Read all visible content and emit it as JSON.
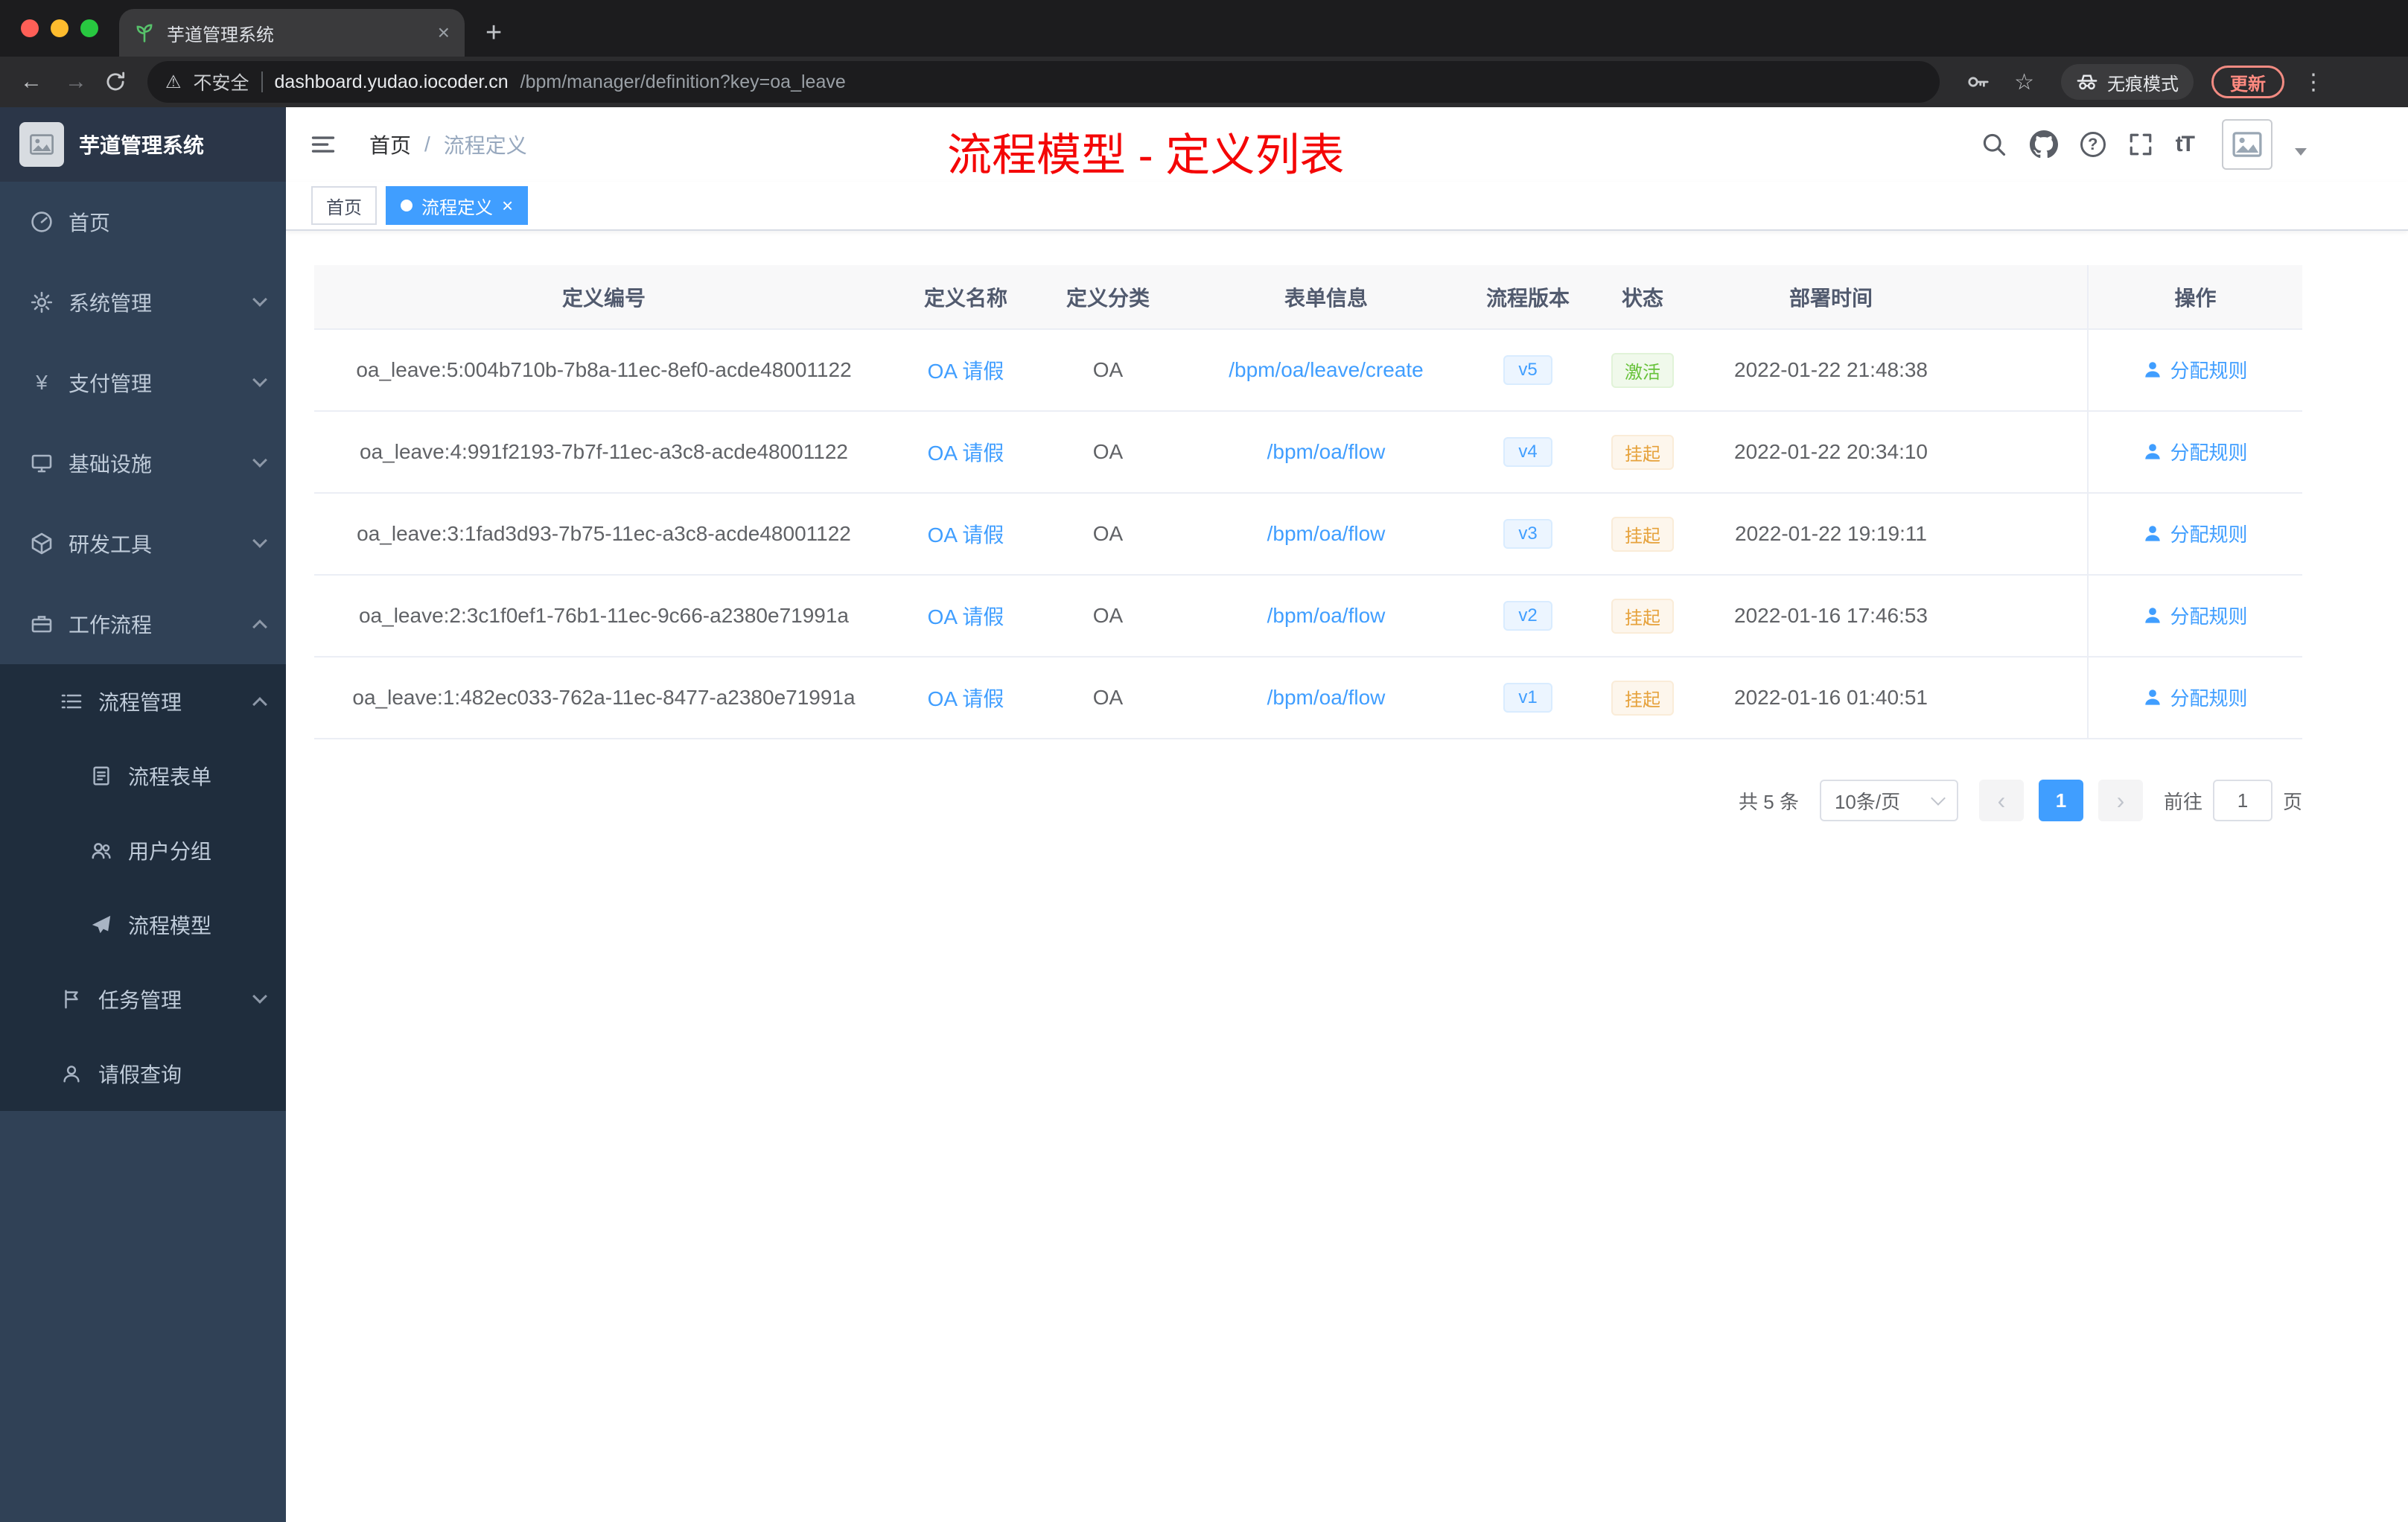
{
  "browser": {
    "tab_title": "芋道管理系统",
    "new_tab": "+",
    "close": "×",
    "security_label": "不安全",
    "url_host": "dashboard.yudao.iocoder.cn",
    "url_path": "/bpm/manager/definition?key=oa_leave",
    "incognito_label": "无痕模式",
    "update_label": "更新"
  },
  "icons": {
    "back": "←",
    "forward": "→",
    "star": "☆",
    "kebab": "⋮",
    "warning": "⚠",
    "help": "?",
    "yen": "¥"
  },
  "sidebar": {
    "app_title": "芋道管理系统",
    "items": [
      {
        "label": "首页"
      },
      {
        "label": "系统管理"
      },
      {
        "label": "支付管理"
      },
      {
        "label": "基础设施"
      },
      {
        "label": "研发工具"
      },
      {
        "label": "工作流程"
      },
      {
        "label": "流程管理"
      },
      {
        "label": "流程表单"
      },
      {
        "label": "用户分组"
      },
      {
        "label": "流程模型"
      },
      {
        "label": "任务管理"
      },
      {
        "label": "请假查询"
      }
    ]
  },
  "header": {
    "breadcrumb_home": "首页",
    "breadcrumb_separator": "/",
    "breadcrumb_current": "流程定义",
    "annotation": "流程模型 - 定义列表",
    "font_size_icon": "tT"
  },
  "tags": {
    "home": "首页",
    "active": "流程定义",
    "close": "×"
  },
  "table": {
    "columns": [
      "定义编号",
      "定义名称",
      "定义分类",
      "表单信息",
      "流程版本",
      "状态",
      "部署时间",
      "操作"
    ],
    "rows": [
      {
        "id": "oa_leave:5:004b710b-7b8a-11ec-8ef0-acde48001122",
        "name": "OA 请假",
        "category": "OA",
        "form": "/bpm/oa/leave/create",
        "version": "v5",
        "status": "激活",
        "status_type": "success",
        "time": "2022-01-22 21:48:38",
        "action": "分配规则"
      },
      {
        "id": "oa_leave:4:991f2193-7b7f-11ec-a3c8-acde48001122",
        "name": "OA 请假",
        "category": "OA",
        "form": "/bpm/oa/flow",
        "version": "v4",
        "status": "挂起",
        "status_type": "warning",
        "time": "2022-01-22 20:34:10",
        "action": "分配规则"
      },
      {
        "id": "oa_leave:3:1fad3d93-7b75-11ec-a3c8-acde48001122",
        "name": "OA 请假",
        "category": "OA",
        "form": "/bpm/oa/flow",
        "version": "v3",
        "status": "挂起",
        "status_type": "warning",
        "time": "2022-01-22 19:19:11",
        "action": "分配规则"
      },
      {
        "id": "oa_leave:2:3c1f0ef1-76b1-11ec-9c66-a2380e71991a",
        "name": "OA 请假",
        "category": "OA",
        "form": "/bpm/oa/flow",
        "version": "v2",
        "status": "挂起",
        "status_type": "warning",
        "time": "2022-01-16 17:46:53",
        "action": "分配规则"
      },
      {
        "id": "oa_leave:1:482ec033-762a-11ec-8477-a2380e71991a",
        "name": "OA 请假",
        "category": "OA",
        "form": "/bpm/oa/flow",
        "version": "v1",
        "status": "挂起",
        "status_type": "warning",
        "time": "2022-01-16 01:40:51",
        "action": "分配规则"
      }
    ]
  },
  "pagination": {
    "total": "共 5 条",
    "page_size": "10条/页",
    "prev": "‹",
    "page": "1",
    "next": "›",
    "goto_label": "前往",
    "goto_value": "1",
    "goto_unit": "页"
  },
  "colors": {
    "accent_blue": "#409eff",
    "success_green": "#67c23a",
    "warning_orange": "#e6a23c",
    "annotation_red": "#f40606",
    "sidebar_bg": "#304156",
    "sidebar_submenu_bg": "#1f2d3d"
  }
}
